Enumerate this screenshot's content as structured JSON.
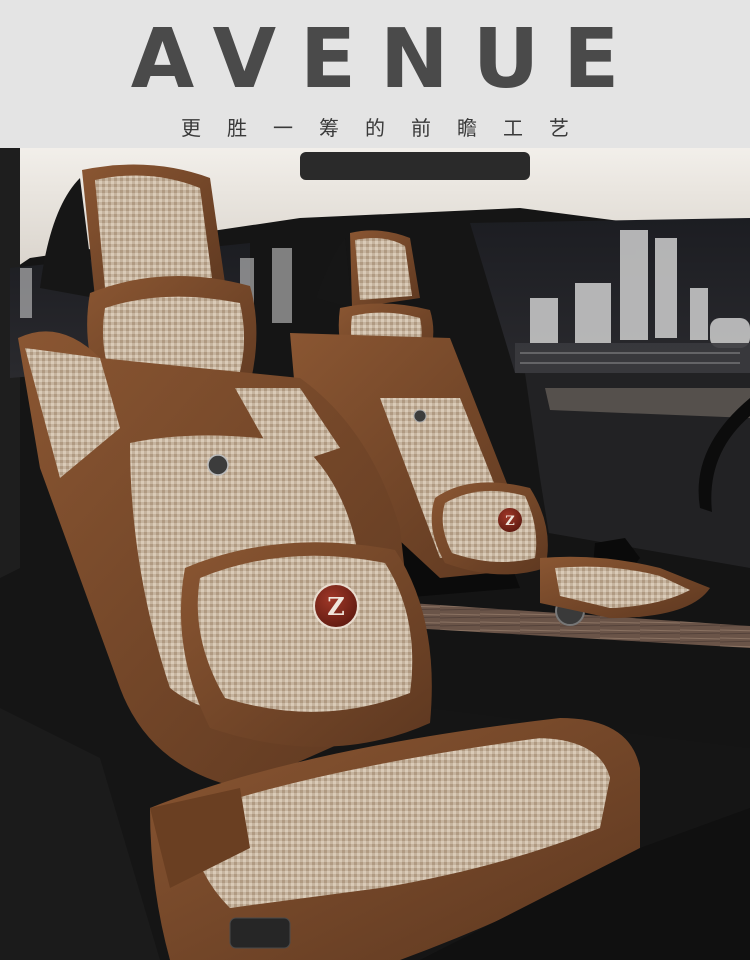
{
  "header": {
    "brand": "AVENUE",
    "tagline": "更胜一筹的前瞻工艺"
  },
  "photo": {
    "subject": "car-interior-front-seats",
    "colors": {
      "fabric_brown": "#7a4a2a",
      "weave_beige": "#c9b8a4",
      "cabin_dark": "#1a1a1a",
      "headliner": "#e8e4df",
      "badge_red": "#7a2418"
    },
    "badge_letter": "Z"
  }
}
